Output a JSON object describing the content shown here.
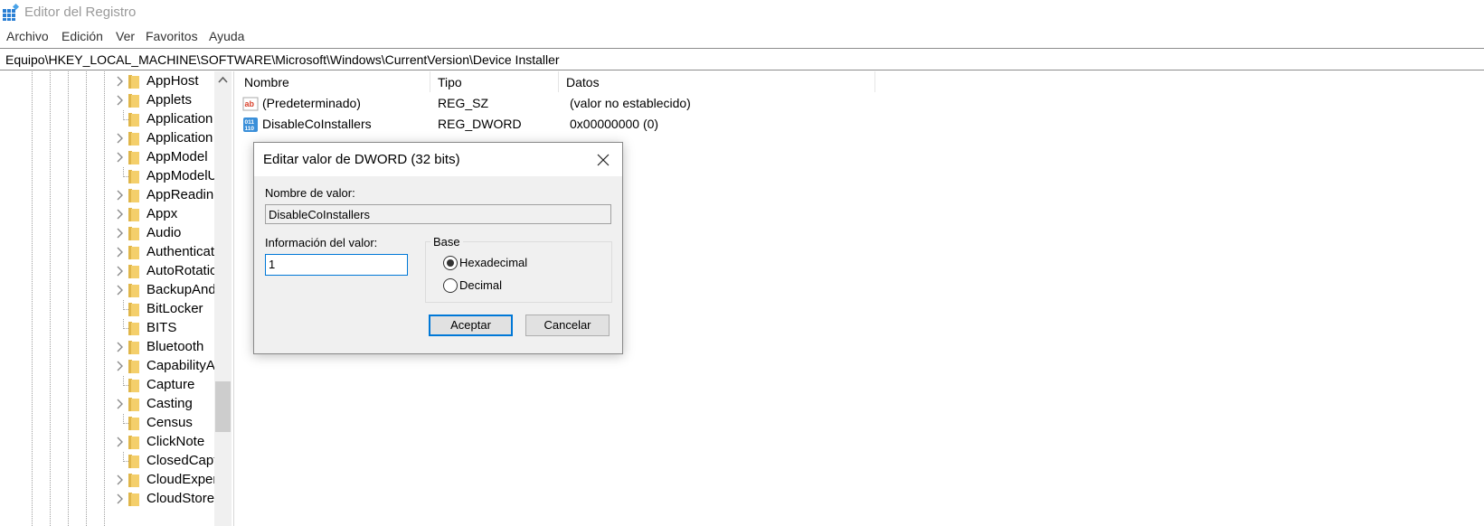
{
  "window": {
    "title": "Editor del Registro",
    "app_icon": "registry-editor-icon"
  },
  "menu": {
    "items": [
      "Archivo",
      "Edición",
      "Ver",
      "Favoritos",
      "Ayuda"
    ]
  },
  "address": {
    "path": "Equipo\\HKEY_LOCAL_MACHINE\\SOFTWARE\\Microsoft\\Windows\\CurrentVersion\\Device Installer"
  },
  "tree": {
    "items": [
      {
        "label": "AppHost",
        "expandable": true
      },
      {
        "label": "Applets",
        "expandable": true
      },
      {
        "label": "Application",
        "expandable": false
      },
      {
        "label": "Application",
        "expandable": true
      },
      {
        "label": "AppModel",
        "expandable": true
      },
      {
        "label": "AppModelU",
        "expandable": false
      },
      {
        "label": "AppReadine",
        "expandable": true
      },
      {
        "label": "Appx",
        "expandable": true
      },
      {
        "label": "Audio",
        "expandable": true
      },
      {
        "label": "Authenticat",
        "expandable": true
      },
      {
        "label": "AutoRotatic",
        "expandable": true
      },
      {
        "label": "BackupAndI",
        "expandable": true
      },
      {
        "label": "BitLocker",
        "expandable": false
      },
      {
        "label": "BITS",
        "expandable": false
      },
      {
        "label": "Bluetooth",
        "expandable": true
      },
      {
        "label": "CapabilityA",
        "expandable": true
      },
      {
        "label": "Capture",
        "expandable": false
      },
      {
        "label": "Casting",
        "expandable": true
      },
      {
        "label": "Census",
        "expandable": false
      },
      {
        "label": "ClickNote",
        "expandable": true
      },
      {
        "label": "ClosedCapt",
        "expandable": false
      },
      {
        "label": "CloudExper",
        "expandable": true
      },
      {
        "label": "CloudStore",
        "expandable": true
      }
    ]
  },
  "list": {
    "columns": [
      "Nombre",
      "Tipo",
      "Datos"
    ],
    "rows": [
      {
        "icon": "string-value-icon",
        "name": "(Predeterminado)",
        "type": "REG_SZ",
        "data": "(valor no establecido)"
      },
      {
        "icon": "binary-value-icon",
        "name": "DisableCoInstallers",
        "type": "REG_DWORD",
        "data": "0x00000000 (0)"
      }
    ]
  },
  "dialog": {
    "title": "Editar valor de DWORD (32 bits)",
    "name_label": "Nombre de valor:",
    "name_value": "DisableCoInstallers",
    "data_label": "Información del valor:",
    "data_value": "1",
    "base_label": "Base",
    "base_options": [
      {
        "label": "Hexadecimal",
        "selected": true
      },
      {
        "label": "Decimal",
        "selected": false
      }
    ],
    "ok_label": "Aceptar",
    "cancel_label": "Cancelar"
  },
  "colors": {
    "accent": "#0078d7",
    "folder": "#f4cf6b",
    "title_text": "#9a9a9a"
  }
}
